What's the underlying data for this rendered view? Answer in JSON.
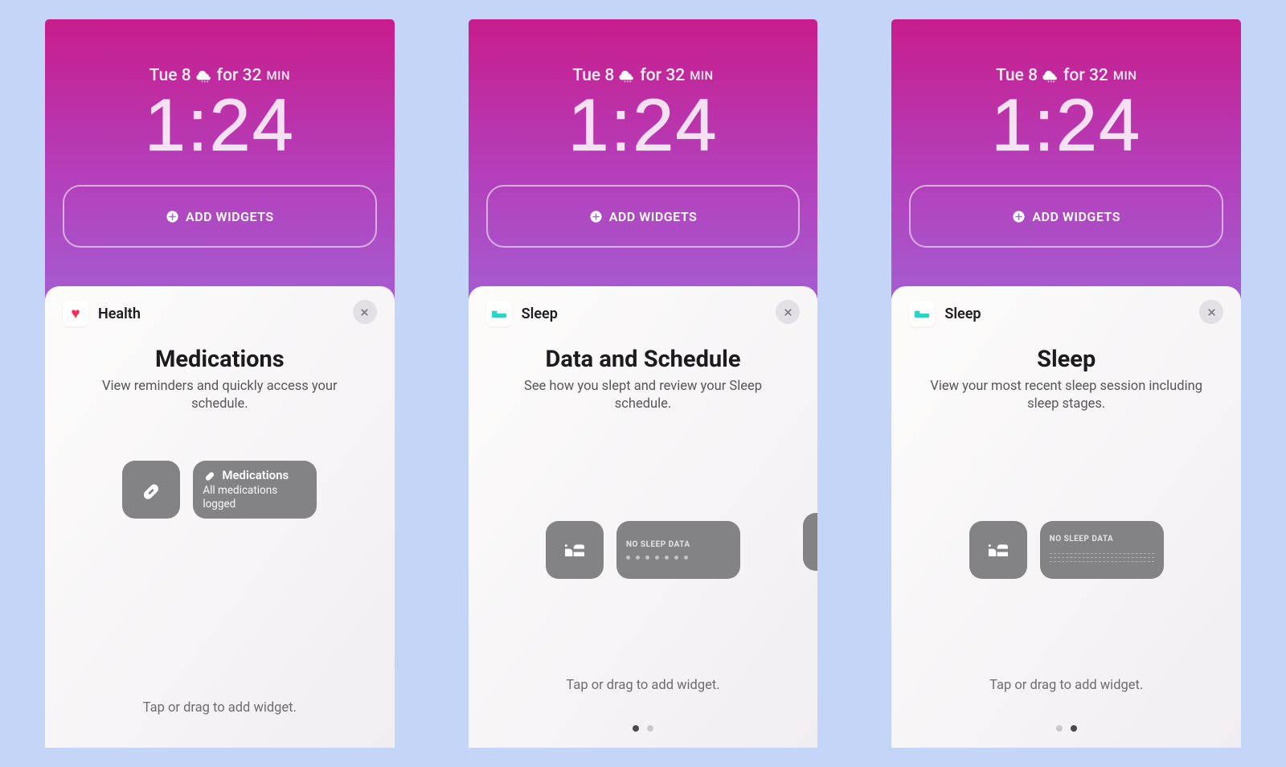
{
  "common": {
    "date": "Tue 8",
    "forecast": "for 32",
    "forecast_suffix": "MIN",
    "time": "1:24",
    "add_widgets_label": "ADD WIDGETS",
    "helper": "Tap or drag to add widget."
  },
  "screens": [
    {
      "app_name": "Health",
      "app_icon": "heart",
      "widget_title": "Medications",
      "widget_desc": "View reminders and quickly access your schedule.",
      "preview": {
        "type": "medications",
        "small_icon": "pill",
        "large_title": "Medications",
        "large_subtitle": "All medications logged"
      },
      "pager": null
    },
    {
      "app_name": "Sleep",
      "app_icon": "bed",
      "widget_title": "Data and Schedule",
      "widget_desc": "See how you slept and review your Sleep schedule.",
      "preview": {
        "type": "sleep-dots",
        "small_icon": "bed",
        "no_sleep_label": "NO SLEEP DATA"
      },
      "pager": {
        "count": 2,
        "active": 0
      }
    },
    {
      "app_name": "Sleep",
      "app_icon": "bed",
      "widget_title": "Sleep",
      "widget_desc": "View your most recent sleep session including sleep stages.",
      "preview": {
        "type": "sleep-lines",
        "small_icon": "bed",
        "no_sleep_label": "NO SLEEP DATA"
      },
      "pager": {
        "count": 2,
        "active": 1
      }
    }
  ]
}
